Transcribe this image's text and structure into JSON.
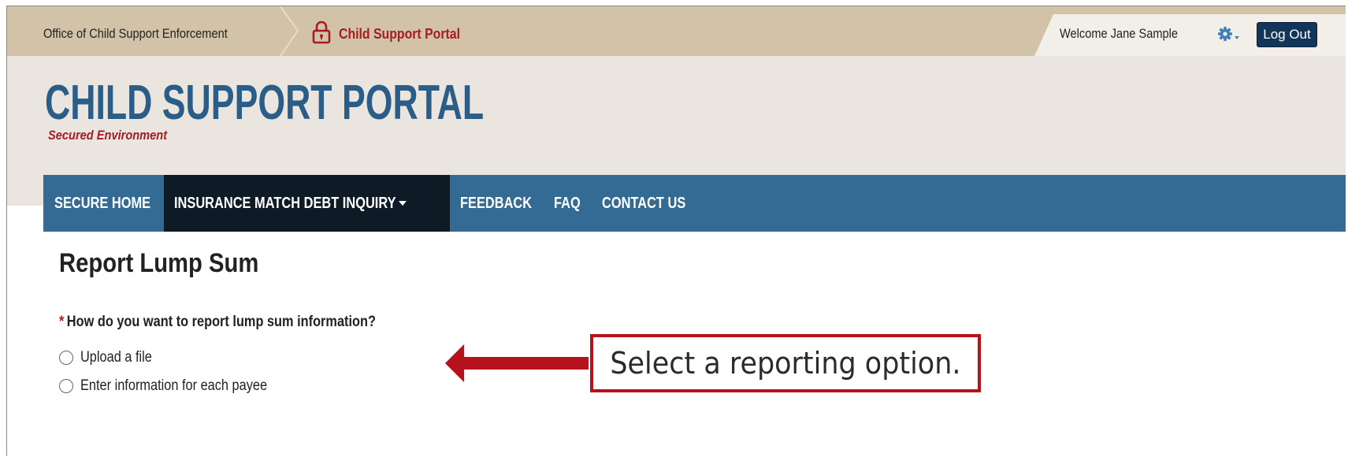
{
  "topbar": {
    "agency": "Office of Child Support Enforcement",
    "portal_link": "Child Support Portal",
    "welcome": "Welcome Jane Sample",
    "logout_label": "Log Out",
    "settings_icon": "gear-icon",
    "lock_icon": "lock-icon"
  },
  "header": {
    "title": "CHILD SUPPORT PORTAL",
    "subtitle": "Secured Environment"
  },
  "nav": {
    "items": [
      {
        "label": "SECURE HOME"
      },
      {
        "label": "INSURANCE MATCH DEBT INQUIRY",
        "active": true,
        "has_dropdown": true
      },
      {
        "label": "FEEDBACK"
      },
      {
        "label": "FAQ"
      },
      {
        "label": "CONTACT US"
      }
    ]
  },
  "main": {
    "title": "Report Lump Sum",
    "required_mark": "*",
    "question": "How do you want to report lump sum information?",
    "options": [
      {
        "label": "Upload a file",
        "selected": false
      },
      {
        "label": "Enter information for each payee",
        "selected": false
      }
    ]
  },
  "callout": {
    "text": "Select a reporting option."
  },
  "colors": {
    "topbar": "#d2c3a8",
    "header_bg": "#eae6df",
    "nav": "#336b95",
    "nav_active": "#0e1b26",
    "title_blue": "#2a5d88",
    "accent_red": "#a31d22",
    "logout_bg": "#14355a",
    "callout_red": "#b5121b"
  }
}
